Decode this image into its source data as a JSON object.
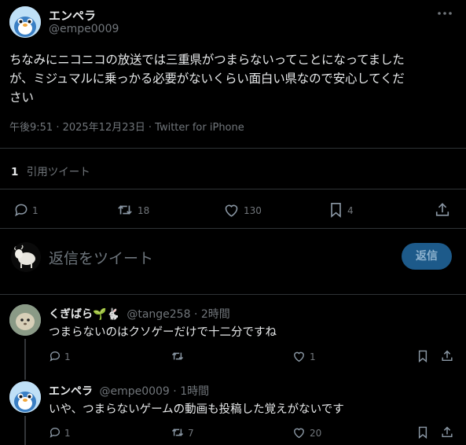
{
  "tweet": {
    "author_name": "エンペラ",
    "author_handle": "@empe0009",
    "text_line1": "ちなみにニコニコの放送では三重県がつまらないってことになってました",
    "text_line2": "が、ミジュマルに乗っかる必要がないくらい面白い県なので安心してくだ",
    "text_line3": "さい",
    "meta": "午後9:51 · 2025年12月23日 · Twitter for iPhone",
    "quote_count": "1",
    "quote_label": "引用ツイート",
    "actions": {
      "replies": "1",
      "retweets": "18",
      "likes": "130",
      "bookmarks": "4"
    }
  },
  "composer": {
    "placeholder": "返信をツイート",
    "button_label": "返信"
  },
  "replies": [
    {
      "author_name": "くぎばら🌱🐇",
      "author_handle": "@tange258",
      "time": "2時間",
      "text": "つまらないのはクソゲーだけで十二分ですね",
      "replies": "1",
      "retweets": "",
      "likes": "1"
    },
    {
      "author_name": "エンペラ",
      "author_handle": "@empe0009",
      "time": "1時間",
      "text": "いや、つまらないゲームの動画も投稿した覚えがないです",
      "replies": "1",
      "retweets": "7",
      "likes": "20"
    }
  ],
  "colors": {
    "background": "#000000",
    "text": "#e7e9ea",
    "muted": "#71767b",
    "divider": "#2f3336",
    "reply_button": "#1d5a8a"
  }
}
